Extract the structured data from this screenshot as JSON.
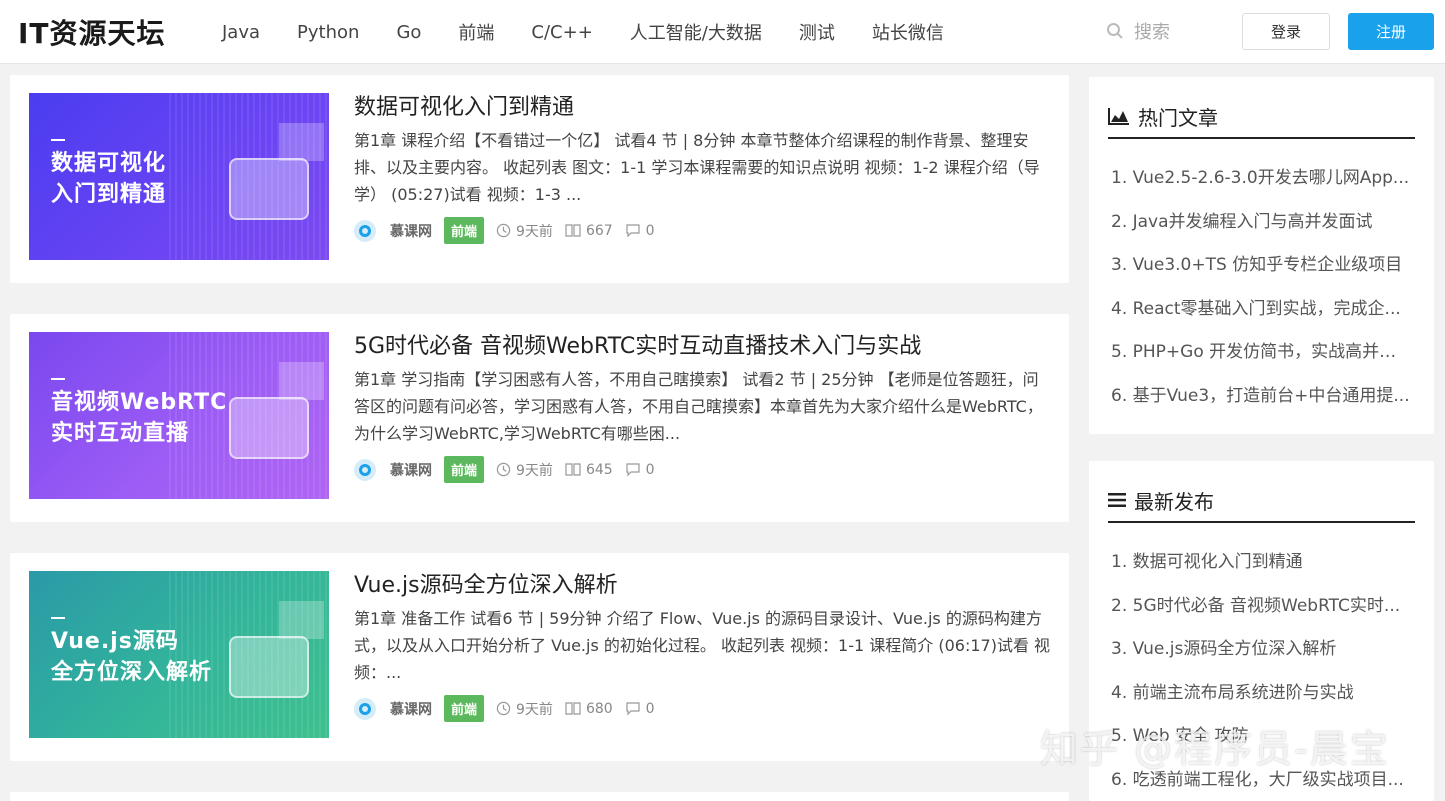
{
  "header": {
    "logo": "IT资源天坛",
    "nav": [
      "Java",
      "Python",
      "Go",
      "前端",
      "C/C++",
      "人工智能/大数据",
      "测试",
      "站长微信"
    ],
    "search_placeholder": "搜索",
    "login_label": "登录",
    "register_label": "注册"
  },
  "articles": [
    {
      "thumb_text": [
        "数据可视化",
        "入门到精通"
      ],
      "thumb_color": "#5b3ff0",
      "title": "数据可视化入门到精通",
      "desc": "第1章 课程介绍【不看错过一个亿】 试看4 节 | 8分钟 本章节整体介绍课程的制作背景、整理安排、以及主要内容。 收起列表 图文：1-1 学习本课程需要的知识点说明 视频：1-2 课程介绍（导学） (05:27)试看 视频：1-3 ...",
      "author": "慕课网",
      "tag": "前端",
      "time": "9天前",
      "views": "667",
      "comments": "0"
    },
    {
      "thumb_text": [
        "音视频WebRTC",
        "实时互动直播"
      ],
      "thumb_color": "#8a55f0",
      "title": "5G时代必备 音视频WebRTC实时互动直播技术入门与实战",
      "desc": "第1章 学习指南【学习困惑有人答，不用自己瞎摸索】 试看2 节 | 25分钟 【老师是位答题狂，问答区的问题有问必答，学习困惑有人答，不用自己瞎摸索】本章首先为大家介绍什么是WebRTC，为什么学习WebRTC,学习WebRTC有哪些困...",
      "author": "慕课网",
      "tag": "前端",
      "time": "9天前",
      "views": "645",
      "comments": "0"
    },
    {
      "thumb_text": [
        "Vue.js源码",
        "全方位深入解析"
      ],
      "thumb_color": "#2aa6a0",
      "title": "Vue.js源码全方位深入解析",
      "desc": "第1章 准备工作 试看6 节 | 59分钟 介绍了 Flow、Vue.js 的源码目录设计、Vue.js 的源码构建方式，以及从入口开始分析了 Vue.js 的初始化过程。 收起列表 视频：1-1 课程简介 (06:17)试看 视频：...",
      "author": "慕课网",
      "tag": "前端",
      "time": "9天前",
      "views": "680",
      "comments": "0"
    }
  ],
  "hot": {
    "title": "热门文章",
    "items": [
      "1. Vue2.5-2.6-3.0开发去哪儿网App...",
      "2. Java并发编程入门与高并发面试",
      "3. Vue3.0+TS 仿知乎专栏企业级项目",
      "4. React零基础入门到实战，完成企...",
      "5. PHP+Go 开发仿简书，实战高并发...",
      "6. 基于Vue3，打造前台+中台通用提..."
    ]
  },
  "latest": {
    "title": "最新发布",
    "items": [
      "1. 数据可视化入门到精通",
      "2. 5G时代必备 音视频WebRTC实时...",
      "3. Vue.js源码全方位深入解析",
      "4. 前端主流布局系统进阶与实战",
      "5. Web 安全 攻防",
      "6. 吃透前端工程化，大厂级实战项目..."
    ]
  },
  "watermark": "知乎 @程序员-晨宝"
}
